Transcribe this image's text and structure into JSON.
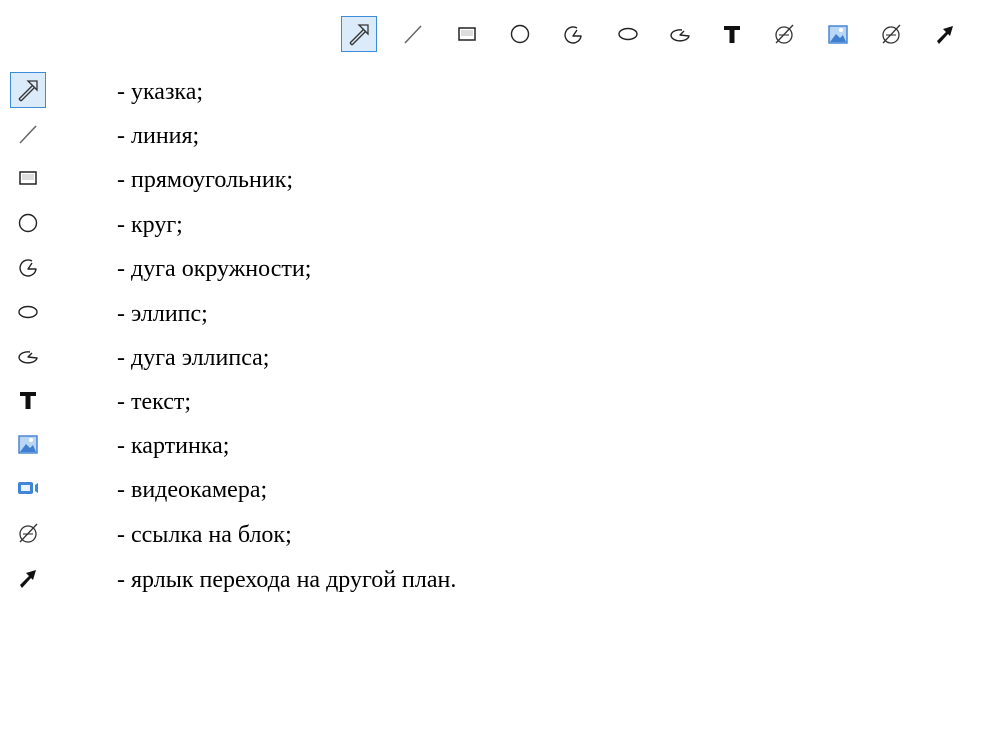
{
  "toolbar": {
    "buttons": [
      {
        "icon": "pointer-icon",
        "active": true
      },
      {
        "icon": "line-icon"
      },
      {
        "icon": "rectangle-icon"
      },
      {
        "icon": "circle-icon"
      },
      {
        "icon": "circle-arc-icon"
      },
      {
        "icon": "ellipse-icon"
      },
      {
        "icon": "ellipse-arc-icon"
      },
      {
        "icon": "text-icon"
      },
      {
        "icon": "block-link-icon"
      },
      {
        "icon": "picture-icon"
      },
      {
        "icon": "block-link-icon"
      },
      {
        "icon": "plan-shortcut-icon"
      }
    ]
  },
  "legend": {
    "items": [
      {
        "icon": "pointer-icon",
        "label": "- указка;"
      },
      {
        "icon": "line-icon",
        "label": "- линия;"
      },
      {
        "icon": "rectangle-icon",
        "label": "- прямоугольник;"
      },
      {
        "icon": "circle-icon",
        "label": "- круг;"
      },
      {
        "icon": "circle-arc-icon",
        "label": "- дуга окружности;"
      },
      {
        "icon": "ellipse-icon",
        "label": "- эллипс;"
      },
      {
        "icon": "ellipse-arc-icon",
        "label": "- дуга эллипса;"
      },
      {
        "icon": "text-icon",
        "label": "- текст;"
      },
      {
        "icon": "picture-icon",
        "label": "- картинка;"
      },
      {
        "icon": "videocamera-icon",
        "label": "- видеокамера;"
      },
      {
        "icon": "block-link-icon",
        "label": "- ссылка на блок;"
      },
      {
        "icon": "plan-shortcut-icon",
        "label": "- ярлык перехода на другой план."
      }
    ]
  },
  "colors": {
    "active_border": "#3c8bd9",
    "active_fill": "#dcebfa",
    "picture_blue": "#3f7fd0",
    "camera_blue": "#3f87d6"
  }
}
